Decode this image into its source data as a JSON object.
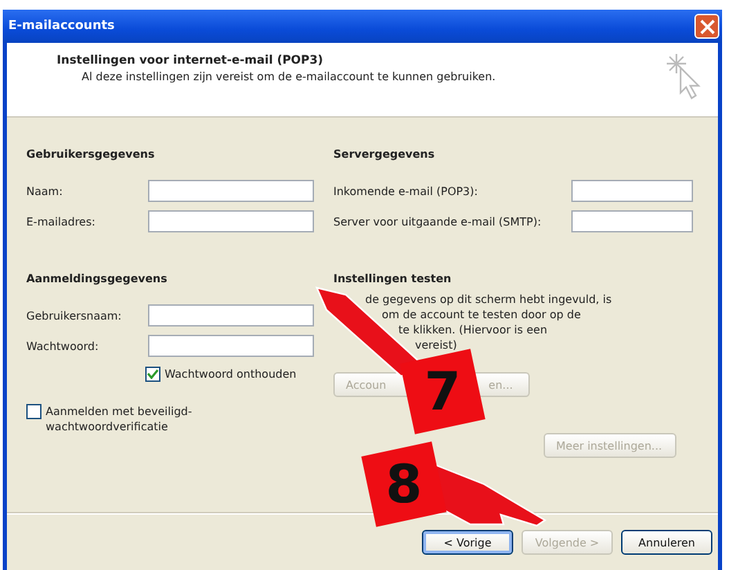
{
  "window": {
    "title": "E-mailaccounts"
  },
  "header": {
    "title": "Instellingen voor internet-e-mail (POP3)",
    "subtitle": "Al deze instellingen zijn vereist om de e-mailaccount te kunnen gebruiken."
  },
  "columns": [
    {
      "sections": [
        {
          "heading": "Gebruikersgegevens",
          "fields": [
            {
              "label": "Naam:"
            },
            {
              "label": "E-mailadres:"
            }
          ]
        },
        {
          "heading": "Aanmeldingsgegevens",
          "fields": [
            {
              "label": "Gebruikersnaam:"
            },
            {
              "label": "Wachtwoord:"
            }
          ],
          "checkboxes": [
            {
              "kind": "indented",
              "label": "Wachtwoord onthouden",
              "checked": true
            },
            {
              "kind": "plain",
              "label": "Aanmelden met beveiligd-wachtwoordverificatie",
              "checked": false
            }
          ]
        }
      ]
    },
    {
      "sections": [
        {
          "heading": "Servergegevens",
          "fields": [
            {
              "label": "Inkomende e-mail (POP3):"
            },
            {
              "label": "Server voor uitgaande e-mail (SMTP):"
            }
          ]
        },
        {
          "heading": "Instellingen testen",
          "text_lines": [
            "de gegevens op dit scherm hebt ingevuld, is",
            "om de account te testen door op de",
            "te klikken. (Hiervoor is een",
            "vereist)"
          ],
          "buttons": [
            {
              "label_parts": [
                "Accoun",
                "en..."
              ],
              "disabled": true,
              "kind": "test"
            }
          ]
        },
        {
          "buttons": [
            {
              "label_parts": [
                "Meer instellingen..."
              ],
              "disabled": true,
              "kind": "right"
            }
          ]
        }
      ]
    }
  ],
  "footer_buttons": [
    {
      "label": "< Vorige",
      "disabled": false,
      "focused": true
    },
    {
      "label": "Volgende >",
      "disabled": true,
      "focused": false
    },
    {
      "label": "Annuleren",
      "disabled": false,
      "focused": false
    }
  ],
  "annotations": [
    {
      "number": "7",
      "kind": "point-up-left"
    },
    {
      "number": "8",
      "kind": "point-down-right"
    }
  ]
}
